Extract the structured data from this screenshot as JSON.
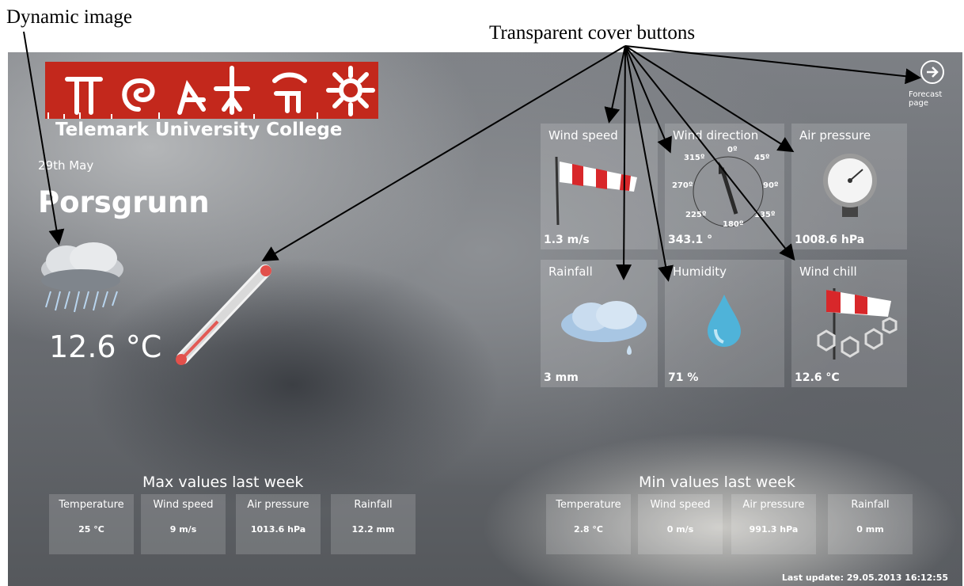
{
  "annotations": {
    "dynamic_image": "Dynamic image",
    "cover_buttons": "Transparent cover buttons"
  },
  "header": {
    "college": "Telemark University College",
    "date": "29th May",
    "city": "Porsgrunn"
  },
  "current": {
    "temperature": "12.6 °C"
  },
  "forecast": {
    "label": "Forecast page"
  },
  "tiles": [
    {
      "title": "Wind speed",
      "value": "1.3 m/s",
      "icon": "windsock-icon"
    },
    {
      "title": "Wind direction",
      "value": "343.1 °",
      "icon": "compass-icon"
    },
    {
      "title": "Air  pressure",
      "value": "1008.6 hPa",
      "icon": "pressure-gauge-icon"
    },
    {
      "title": "Rainfall",
      "value": "3 mm",
      "icon": "rain-cloud-icon"
    },
    {
      "title": "Humidity",
      "value": "71 %",
      "icon": "water-drop-icon"
    },
    {
      "title": "Wind chill",
      "value": "12.6 °C",
      "icon": "wind-chill-icon"
    }
  ],
  "compass": {
    "labels": [
      "0º",
      "45º",
      "90º",
      "135º",
      "180º",
      "225º",
      "270º",
      "315º"
    ]
  },
  "max_week": {
    "title": "Max values last week",
    "items": [
      {
        "label": "Temperature",
        "value": "25 °C"
      },
      {
        "label": "Wind speed",
        "value": "9 m/s"
      },
      {
        "label": "Air pressure",
        "value": "1013.6 hPa"
      },
      {
        "label": "Rainfall",
        "value": "12.2 mm"
      }
    ]
  },
  "min_week": {
    "title": "Min values last week",
    "items": [
      {
        "label": "Temperature",
        "value": "2.8 °C"
      },
      {
        "label": "Wind speed",
        "value": "0 m/s"
      },
      {
        "label": "Air pressure",
        "value": "991.3 hPa"
      },
      {
        "label": "Rainfall",
        "value": "0 mm"
      }
    ]
  },
  "footer": {
    "last_update": "Last update: 29.05.2013 16:12:55"
  },
  "colors": {
    "logo_red": "#c3281c"
  }
}
